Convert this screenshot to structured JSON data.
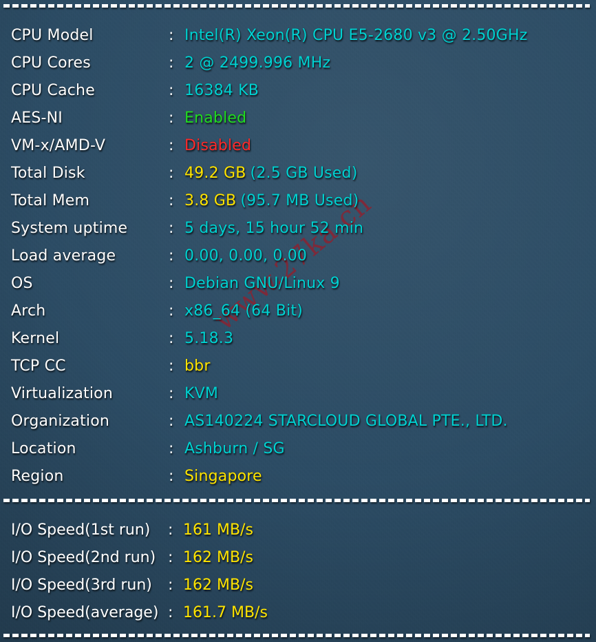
{
  "separators": {
    "top": "dashed-rule",
    "middle": "dashed-rule",
    "bottom": "dashed-rule"
  },
  "colors": {
    "background": "#2c4c65",
    "label": "#ffffff",
    "cyan": "#00d2d2",
    "yellow": "#ffe400",
    "green": "#22dd22",
    "red": "#ff2b2b",
    "watermark": "#8d2230"
  },
  "separator_char": ":",
  "system_info": [
    {
      "label": "CPU Model",
      "value": "Intel(R) Xeon(R) CPU E5-2680 v3 @ 2.50GHz",
      "color": "c-cyan",
      "sub": "",
      "sub_color": ""
    },
    {
      "label": "CPU Cores",
      "value": "2 @ 2499.996 MHz",
      "color": "c-cyan",
      "sub": "",
      "sub_color": ""
    },
    {
      "label": "CPU Cache",
      "value": "16384 KB",
      "color": "c-cyan",
      "sub": "",
      "sub_color": ""
    },
    {
      "label": "AES-NI",
      "value": "Enabled",
      "color": "c-green",
      "sub": "",
      "sub_color": ""
    },
    {
      "label": "VM-x/AMD-V",
      "value": "Disabled",
      "color": "c-red",
      "sub": "",
      "sub_color": ""
    },
    {
      "label": "Total Disk",
      "value": "49.2 GB",
      "color": "c-yellow",
      "sub": "(2.5 GB Used)",
      "sub_color": "c-cyan"
    },
    {
      "label": "Total Mem",
      "value": "3.8 GB",
      "color": "c-yellow",
      "sub": "(95.7 MB Used)",
      "sub_color": "c-cyan"
    },
    {
      "label": "System uptime",
      "value": "5 days, 15 hour 52 min",
      "color": "c-cyan",
      "sub": "",
      "sub_color": ""
    },
    {
      "label": "Load average",
      "value": "0.00, 0.00, 0.00",
      "color": "c-cyan",
      "sub": "",
      "sub_color": ""
    },
    {
      "label": "OS",
      "value": "Debian GNU/Linux 9",
      "color": "c-cyan",
      "sub": "",
      "sub_color": ""
    },
    {
      "label": "Arch",
      "value": "x86_64 (64 Bit)",
      "color": "c-cyan",
      "sub": "",
      "sub_color": ""
    },
    {
      "label": "Kernel",
      "value": "5.18.3",
      "color": "c-cyan",
      "sub": "",
      "sub_color": ""
    },
    {
      "label": "TCP CC",
      "value": "bbr",
      "color": "c-yellow",
      "sub": "",
      "sub_color": ""
    },
    {
      "label": "Virtualization",
      "value": "KVM",
      "color": "c-cyan",
      "sub": "",
      "sub_color": ""
    },
    {
      "label": "Organization",
      "value": "AS140224 STARCLOUD GLOBAL PTE., LTD.",
      "color": "c-cyan",
      "sub": "",
      "sub_color": ""
    },
    {
      "label": "Location",
      "value": "Ashburn / SG",
      "color": "c-cyan",
      "sub": "",
      "sub_color": ""
    },
    {
      "label": "Region",
      "value": "Singapore",
      "color": "c-yellow",
      "sub": "",
      "sub_color": ""
    }
  ],
  "io_speed": [
    {
      "label": "I/O Speed(1st run)",
      "value": "161 MB/s"
    },
    {
      "label": "I/O Speed(2nd run)",
      "value": "162 MB/s"
    },
    {
      "label": "I/O Speed(3rd run)",
      "value": "162 MB/s"
    },
    {
      "label": "I/O Speed(average)",
      "value": "161.7 MB/s"
    }
  ],
  "watermark": {
    "text": "www.27ka.cn"
  }
}
